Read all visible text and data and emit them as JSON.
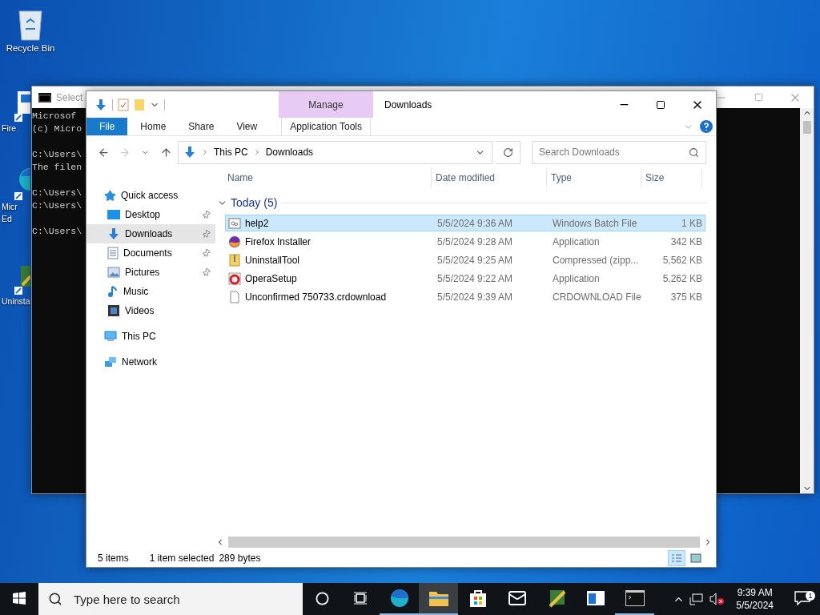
{
  "desktop": {
    "icons": [
      {
        "kind": "recycle",
        "lines": [
          "Recycle Bin"
        ]
      },
      {
        "kind": "firefox",
        "lines": [
          "Fire"
        ]
      },
      {
        "kind": "edge",
        "lines": [
          "Micr",
          "Ed"
        ]
      },
      {
        "kind": "installer",
        "lines": [
          "Uninsta"
        ]
      }
    ]
  },
  "console_window": {
    "title": "Select",
    "blocks": [
      [
        "Microsof",
        "(c) Micro"
      ],
      [
        "C:\\Users\\",
        "The filen"
      ],
      [
        "C:\\Users\\",
        "C:\\Users\\"
      ],
      [
        "C:\\Users\\"
      ]
    ]
  },
  "explorer": {
    "context_tab": "Manage",
    "title": "Downloads",
    "ribbon_tabs": [
      {
        "label": "File",
        "kind": "file"
      },
      {
        "label": "Home",
        "kind": "tab"
      },
      {
        "label": "Share",
        "kind": "tab"
      },
      {
        "label": "View",
        "kind": "tab"
      },
      {
        "label": "Application Tools",
        "kind": "context"
      }
    ],
    "address": [
      "This PC",
      "Downloads"
    ],
    "search": {
      "placeholder": "Search Downloads"
    },
    "nav": [
      {
        "label": "Quick access",
        "kind": "star",
        "children": [
          {
            "label": "Desktop",
            "kind": "desktop",
            "pinned": true,
            "selected": false
          },
          {
            "label": "Downloads",
            "kind": "downloads",
            "pinned": true,
            "selected": true
          },
          {
            "label": "Documents",
            "kind": "documents",
            "pinned": true,
            "selected": false
          },
          {
            "label": "Pictures",
            "kind": "pictures",
            "pinned": true,
            "selected": false
          },
          {
            "label": "Music",
            "kind": "music",
            "pinned": false,
            "selected": false
          },
          {
            "label": "Videos",
            "kind": "videos",
            "pinned": false,
            "selected": false
          }
        ]
      },
      {
        "label": "This PC",
        "kind": "pc"
      },
      {
        "label": "Network",
        "kind": "network"
      }
    ],
    "columns": [
      "Name",
      "Date modified",
      "Type",
      "Size"
    ],
    "group": {
      "label": "Today (5)",
      "expanded": true
    },
    "rows": [
      {
        "kind": "batch",
        "name": "help2",
        "date": "5/5/2024 9:36 AM",
        "type": "Windows Batch File",
        "size": "1 KB",
        "selected": true
      },
      {
        "kind": "firefox",
        "name": "Firefox Installer",
        "date": "5/5/2024 9:28 AM",
        "type": "Application",
        "size": "342 KB",
        "selected": false
      },
      {
        "kind": "zip",
        "name": "UninstallTool",
        "date": "5/5/2024 9:25 AM",
        "type": "Compressed (zipp...",
        "size": "5,562 KB",
        "selected": false
      },
      {
        "kind": "opera",
        "name": "OperaSetup",
        "date": "5/5/2024 9:22 AM",
        "type": "Application",
        "size": "5,262 KB",
        "selected": false
      },
      {
        "kind": "file",
        "name": "Unconfirmed 750733.crdownload",
        "date": "5/5/2024 9:39 AM",
        "type": "CRDOWNLOAD File",
        "size": "375 KB",
        "selected": false
      }
    ],
    "status": {
      "items": "5 items",
      "selection": "1 item selected",
      "bytes": "289 bytes"
    },
    "views": [
      {
        "kind": "details",
        "selected": true
      },
      {
        "kind": "large",
        "selected": false
      }
    ]
  },
  "taskbar": {
    "search": {
      "placeholder": "Type here to search"
    },
    "apps": [
      {
        "kind": "edge",
        "running": true,
        "active": false
      },
      {
        "kind": "explorer",
        "running": true,
        "active": true
      },
      {
        "kind": "store",
        "running": false,
        "active": false
      },
      {
        "kind": "mail",
        "running": false,
        "active": false
      },
      {
        "kind": "installer",
        "running": false,
        "active": false
      },
      {
        "kind": "window",
        "running": false,
        "active": false
      },
      {
        "kind": "console",
        "running": true,
        "active": false
      }
    ],
    "time": "9:39 AM",
    "date": "5/5/2024",
    "notifications": "1"
  }
}
